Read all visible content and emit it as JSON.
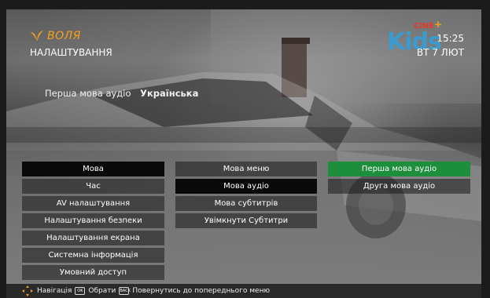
{
  "header": {
    "brand": "ВОЛЯ",
    "title": "НАЛАШТУВАННЯ",
    "channel_logo": {
      "main": "Kids",
      "badge": "CINE",
      "accent": "+"
    },
    "time": "15:25",
    "date": "ВТ 7 ЛЮТ"
  },
  "current_setting": {
    "label": "Перша мова аудіо",
    "value": "Українська"
  },
  "menu": {
    "main": [
      "Мова",
      "Час",
      "AV налаштування",
      "Налаштування безпеки",
      "Налаштування екрана",
      "Системна інформація",
      "Умовний доступ"
    ],
    "language": [
      "Мова меню",
      "Мова аудіо",
      "Мова субтитрів",
      "Увімкнути Субтитри"
    ],
    "audio": [
      "Перша мова аудіо",
      "Друга мова аудіо"
    ]
  },
  "footer": {
    "nav_label": "Навігація",
    "ok_key": "OK",
    "ok_label": "Обрати",
    "back_key": "BACK",
    "back_label": "Повернутись до попереднього меню"
  },
  "colors": {
    "selected": "#1d8e3c",
    "brand": "#f5a21a",
    "kids": "#3b9bd0",
    "cine": "#e43a2c"
  }
}
